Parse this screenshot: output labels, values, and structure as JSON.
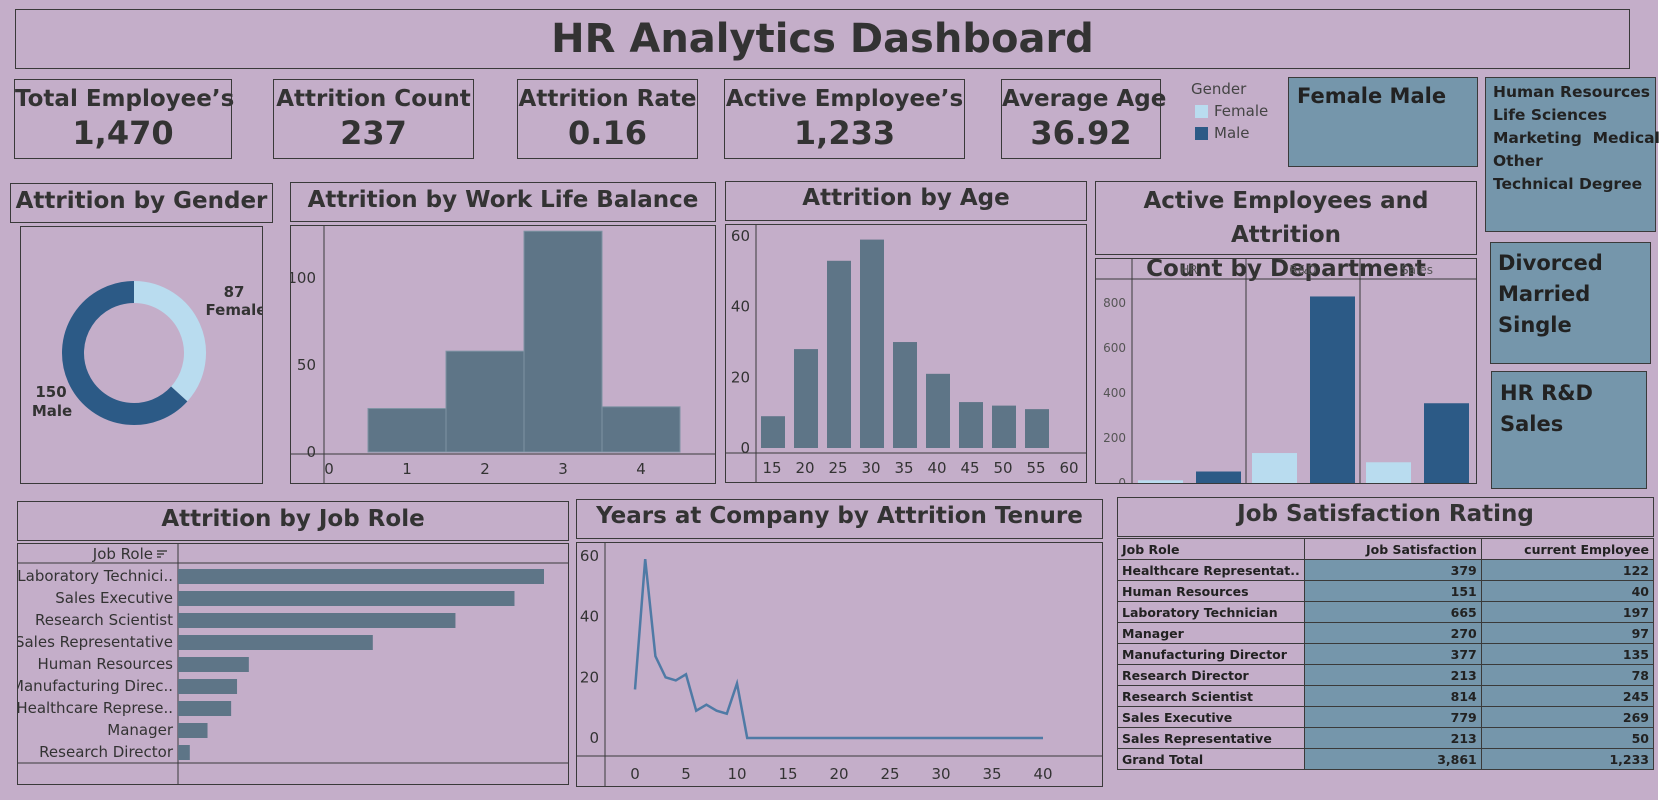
{
  "title": "HR Analytics Dashboard",
  "kpis": [
    {
      "label": "Total Employee’s",
      "value": "1,470"
    },
    {
      "label": "Attrition Count",
      "value": "237"
    },
    {
      "label": "Attrition Rate",
      "value": "0.16"
    },
    {
      "label": "Active Employee’s",
      "value": "1,233"
    },
    {
      "label": "Average Age",
      "value": "36.92"
    }
  ],
  "legend": {
    "title": "Gender",
    "items": [
      {
        "name": "Female",
        "color": "#b9dcef"
      },
      {
        "name": "Male",
        "color": "#2c5a86"
      }
    ]
  },
  "filters": {
    "gender": [
      "Female",
      "Male"
    ],
    "education_field": [
      "Human Resources",
      "Life Sciences",
      "Marketing",
      "Medical",
      "Other",
      "Technical Degree"
    ],
    "marital": [
      "Divorced",
      "Married",
      "Single"
    ],
    "department": [
      "HR",
      "R&D",
      "Sales"
    ]
  },
  "colors": {
    "background": "#c4aec9",
    "bar": "#5e7587",
    "filter": "#7596ab",
    "female": "#b9dcef",
    "male": "#2c5a86",
    "line": "#4f7aa5"
  },
  "panels": {
    "gender": "Attrition by Gender",
    "wlb": "Attrition by Work Life Balance",
    "age": "Attrition by Age",
    "dept_line1": "Active Employees and Attrition",
    "dept_line2": "Count by Department",
    "jobrole": "Attrition by Job Role",
    "years": "Years at Company by Attrition Tenure",
    "satisfaction": "Job Satisfaction Rating"
  },
  "chart_data": [
    {
      "type": "pie",
      "id": "gender",
      "title": "Attrition by Gender",
      "slices": [
        {
          "name": "Female",
          "value": 87
        },
        {
          "name": "Male",
          "value": 150
        }
      ]
    },
    {
      "type": "bar",
      "id": "wlb",
      "title": "Attrition by Work Life Balance",
      "categories": [
        1,
        2,
        3,
        4
      ],
      "values": [
        25,
        58,
        127,
        26
      ],
      "xticks": [
        0,
        1,
        2,
        3,
        4,
        5
      ],
      "yticks": [
        0,
        50,
        100
      ],
      "ylim": [
        0,
        130
      ]
    },
    {
      "type": "bar",
      "id": "age",
      "title": "Attrition by Age",
      "categories": [
        15,
        20,
        25,
        30,
        35,
        40,
        45,
        50,
        55
      ],
      "values": [
        9,
        28,
        53,
        59,
        30,
        21,
        13,
        12,
        11
      ],
      "xticks": [
        15,
        20,
        25,
        30,
        35,
        40,
        45,
        50,
        55,
        60
      ],
      "yticks": [
        0,
        20,
        40,
        60
      ],
      "ylim": [
        0,
        62
      ]
    },
    {
      "type": "bar",
      "id": "dept",
      "title": "Active Employees and Attrition Count by Department",
      "categories": [
        "HR",
        "R&D",
        "Sales"
      ],
      "series": [
        {
          "name": "Attrition",
          "values": [
            12,
            133,
            92
          ]
        },
        {
          "name": "Active",
          "values": [
            51,
            828,
            354
          ]
        }
      ],
      "yticks": [
        0,
        200,
        400,
        600,
        800
      ],
      "ylim": [
        0,
        870
      ]
    },
    {
      "type": "bar",
      "id": "jobrole",
      "title": "Attrition by Job Role",
      "header": "Job Role",
      "categories": [
        "Laboratory Technici..",
        "Sales Executive",
        "Research Scientist",
        "Sales Representative",
        "Human Resources",
        "Manufacturing Direc..",
        "Healthcare Represe..",
        "Manager",
        "Research Director"
      ],
      "values": [
        62,
        57,
        47,
        33,
        12,
        10,
        9,
        5,
        2
      ]
    },
    {
      "type": "line",
      "id": "years",
      "title": "Years at Company by Attrition Tenure",
      "x": [
        0,
        1,
        2,
        3,
        4,
        5,
        6,
        7,
        8,
        9,
        10,
        11,
        12,
        13,
        14,
        15,
        16,
        17,
        18,
        19,
        20,
        21,
        22,
        23,
        24,
        25,
        26,
        27,
        28,
        29,
        30,
        31,
        32,
        33,
        34,
        35,
        36,
        37,
        38,
        39,
        40
      ],
      "y": [
        16,
        59,
        27,
        20,
        19,
        21,
        9,
        11,
        9,
        8,
        18,
        0,
        0,
        0,
        0,
        0,
        0,
        0,
        0,
        0,
        0,
        0,
        0,
        0,
        0,
        0,
        0,
        0,
        0,
        0,
        0,
        0,
        0,
        0,
        0,
        0,
        0,
        0,
        0,
        0,
        0
      ],
      "xticks": [
        0,
        5,
        10,
        15,
        20,
        25,
        30,
        35,
        40
      ],
      "yticks": [
        0,
        20,
        40,
        60
      ],
      "ylim": [
        0,
        62
      ]
    },
    {
      "type": "table",
      "id": "satisfaction",
      "title": "Job Satisfaction Rating",
      "columns": [
        "Job Role",
        "Job Satisfaction",
        "current Employee"
      ],
      "rows": [
        [
          "Healthcare Representat..",
          "379",
          "122"
        ],
        [
          "Human Resources",
          "151",
          "40"
        ],
        [
          "Laboratory Technician",
          "665",
          "197"
        ],
        [
          "Manager",
          "270",
          "97"
        ],
        [
          "Manufacturing Director",
          "377",
          "135"
        ],
        [
          "Research Director",
          "213",
          "78"
        ],
        [
          "Research Scientist",
          "814",
          "245"
        ],
        [
          "Sales Executive",
          "779",
          "269"
        ],
        [
          "Sales Representative",
          "213",
          "50"
        ],
        [
          "Grand Total",
          "3,861",
          "1,233"
        ]
      ]
    }
  ]
}
